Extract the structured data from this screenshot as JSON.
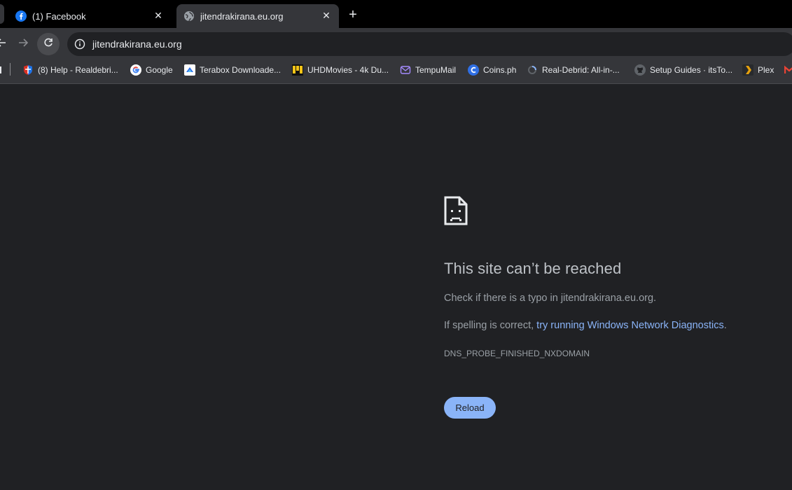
{
  "tabs": [
    {
      "title": "(1) Facebook",
      "favicon": "facebook-icon",
      "active": false
    },
    {
      "title": "jitendrakirana.eu.org",
      "favicon": "globe-icon",
      "active": true
    }
  ],
  "new_tab_glyph": "+",
  "close_glyph": "✕",
  "omnibox": {
    "url": "jitendrakirana.eu.org",
    "info_icon": "info-icon"
  },
  "bookmarks": [
    {
      "label": "(8) Help - Realdebri...",
      "icon": "realdebrid-shield-icon"
    },
    {
      "label": "Google",
      "icon": "google-icon"
    },
    {
      "label": "Terabox Downloade...",
      "icon": "terabox-icon"
    },
    {
      "label": "UHDMovies - 4k Du...",
      "icon": "uhdmovies-icon"
    },
    {
      "label": "TempuMail",
      "icon": "mail-icon"
    },
    {
      "label": "Coins.ph",
      "icon": "coins-icon"
    },
    {
      "label": "Real-Debrid: All-in-...",
      "icon": "realdebrid-spinner-icon"
    },
    {
      "label": "Setup Guides · itsTo...",
      "icon": "github-icon"
    },
    {
      "label": "Plex",
      "icon": "plex-icon"
    }
  ],
  "error": {
    "title": "This site can’t be reached",
    "p1": "Check if there is a typo in jitendrakirana.eu.org.",
    "p2_prefix": "If spelling is correct, ",
    "p2_link": "try running Windows Network Diagnostics",
    "p2_suffix": ".",
    "code": "DNS_PROBE_FINISHED_NXDOMAIN",
    "reload_label": "Reload"
  },
  "colors": {
    "background": "#202124",
    "toolbar": "#35363a",
    "tabstrip": "#000000",
    "link": "#8ab4f8",
    "button": "#8ab4f8"
  }
}
